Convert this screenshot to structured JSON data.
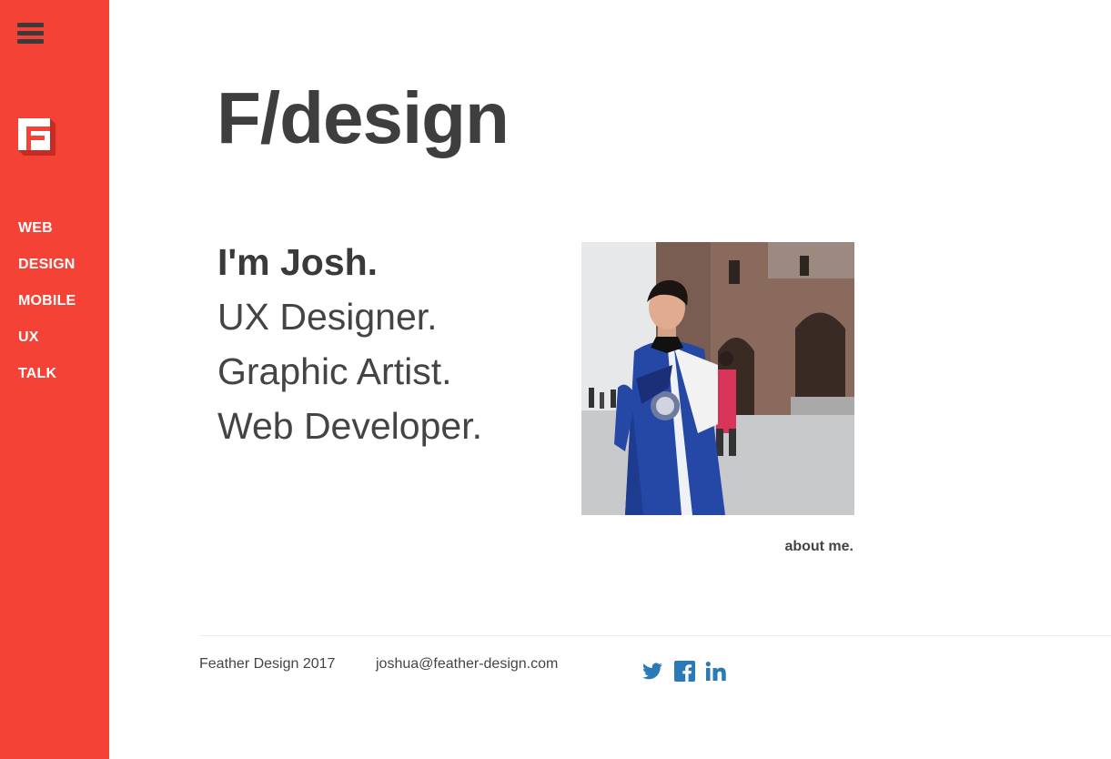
{
  "sidebar": {
    "menu_icon": "hamburger-menu-icon",
    "logo_icon": "feather-design-logo-icon",
    "nav": [
      {
        "label": "WEB"
      },
      {
        "label": "DESIGN"
      },
      {
        "label": "MOBILE"
      },
      {
        "label": "UX"
      },
      {
        "label": "TALK"
      }
    ]
  },
  "main": {
    "brand": "F/design",
    "intro": {
      "name": "I'm Josh.",
      "roles": [
        "UX Designer.",
        "Graphic Artist.",
        "Web Developer."
      ]
    },
    "photo_icon": "profile-photo",
    "about_link": "about me."
  },
  "footer": {
    "copyright": "Feather Design 2017",
    "email": "joshua@feather-design.com",
    "social": [
      {
        "icon": "twitter-icon"
      },
      {
        "icon": "facebook-icon"
      },
      {
        "icon": "linkedin-icon"
      }
    ]
  },
  "colors": {
    "sidebar_bg": "#f44336",
    "text_dark": "#444444",
    "social_blue": "#2a7ab8"
  }
}
